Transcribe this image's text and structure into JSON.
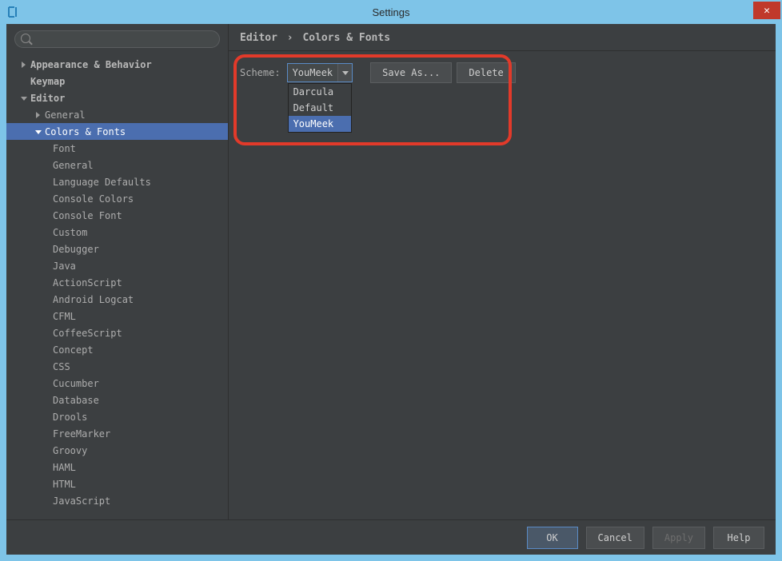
{
  "window": {
    "title": "Settings"
  },
  "sidebar": {
    "search_placeholder": "",
    "items": [
      {
        "label": "Appearance & Behavior",
        "level": 1,
        "arrow": "right"
      },
      {
        "label": "Keymap",
        "level": 1,
        "arrow": "none"
      },
      {
        "label": "Editor",
        "level": 1,
        "arrow": "down"
      },
      {
        "label": "General",
        "level": 2,
        "arrow": "right"
      },
      {
        "label": "Colors & Fonts",
        "level": 2,
        "arrow": "down",
        "selected": true
      },
      {
        "label": "Font",
        "level": 3
      },
      {
        "label": "General",
        "level": 3
      },
      {
        "label": "Language Defaults",
        "level": 3
      },
      {
        "label": "Console Colors",
        "level": 3
      },
      {
        "label": "Console Font",
        "level": 3
      },
      {
        "label": "Custom",
        "level": 3
      },
      {
        "label": "Debugger",
        "level": 3
      },
      {
        "label": "Java",
        "level": 3
      },
      {
        "label": "ActionScript",
        "level": 3
      },
      {
        "label": "Android Logcat",
        "level": 3
      },
      {
        "label": "CFML",
        "level": 3
      },
      {
        "label": "CoffeeScript",
        "level": 3
      },
      {
        "label": "Concept",
        "level": 3
      },
      {
        "label": "CSS",
        "level": 3
      },
      {
        "label": "Cucumber",
        "level": 3
      },
      {
        "label": "Database",
        "level": 3
      },
      {
        "label": "Drools",
        "level": 3
      },
      {
        "label": "FreeMarker",
        "level": 3
      },
      {
        "label": "Groovy",
        "level": 3
      },
      {
        "label": "HAML",
        "level": 3
      },
      {
        "label": "HTML",
        "level": 3
      },
      {
        "label": "JavaScript",
        "level": 3
      }
    ]
  },
  "breadcrumb": {
    "part1": "Editor",
    "sep": "›",
    "part2": "Colors & Fonts"
  },
  "scheme": {
    "label": "Scheme:",
    "selected": "YouMeek",
    "options": [
      "Darcula",
      "Default",
      "YouMeek"
    ],
    "save_as_label": "Save As...",
    "delete_label": "Delete"
  },
  "footer": {
    "ok": "OK",
    "cancel": "Cancel",
    "apply": "Apply",
    "help": "Help"
  }
}
